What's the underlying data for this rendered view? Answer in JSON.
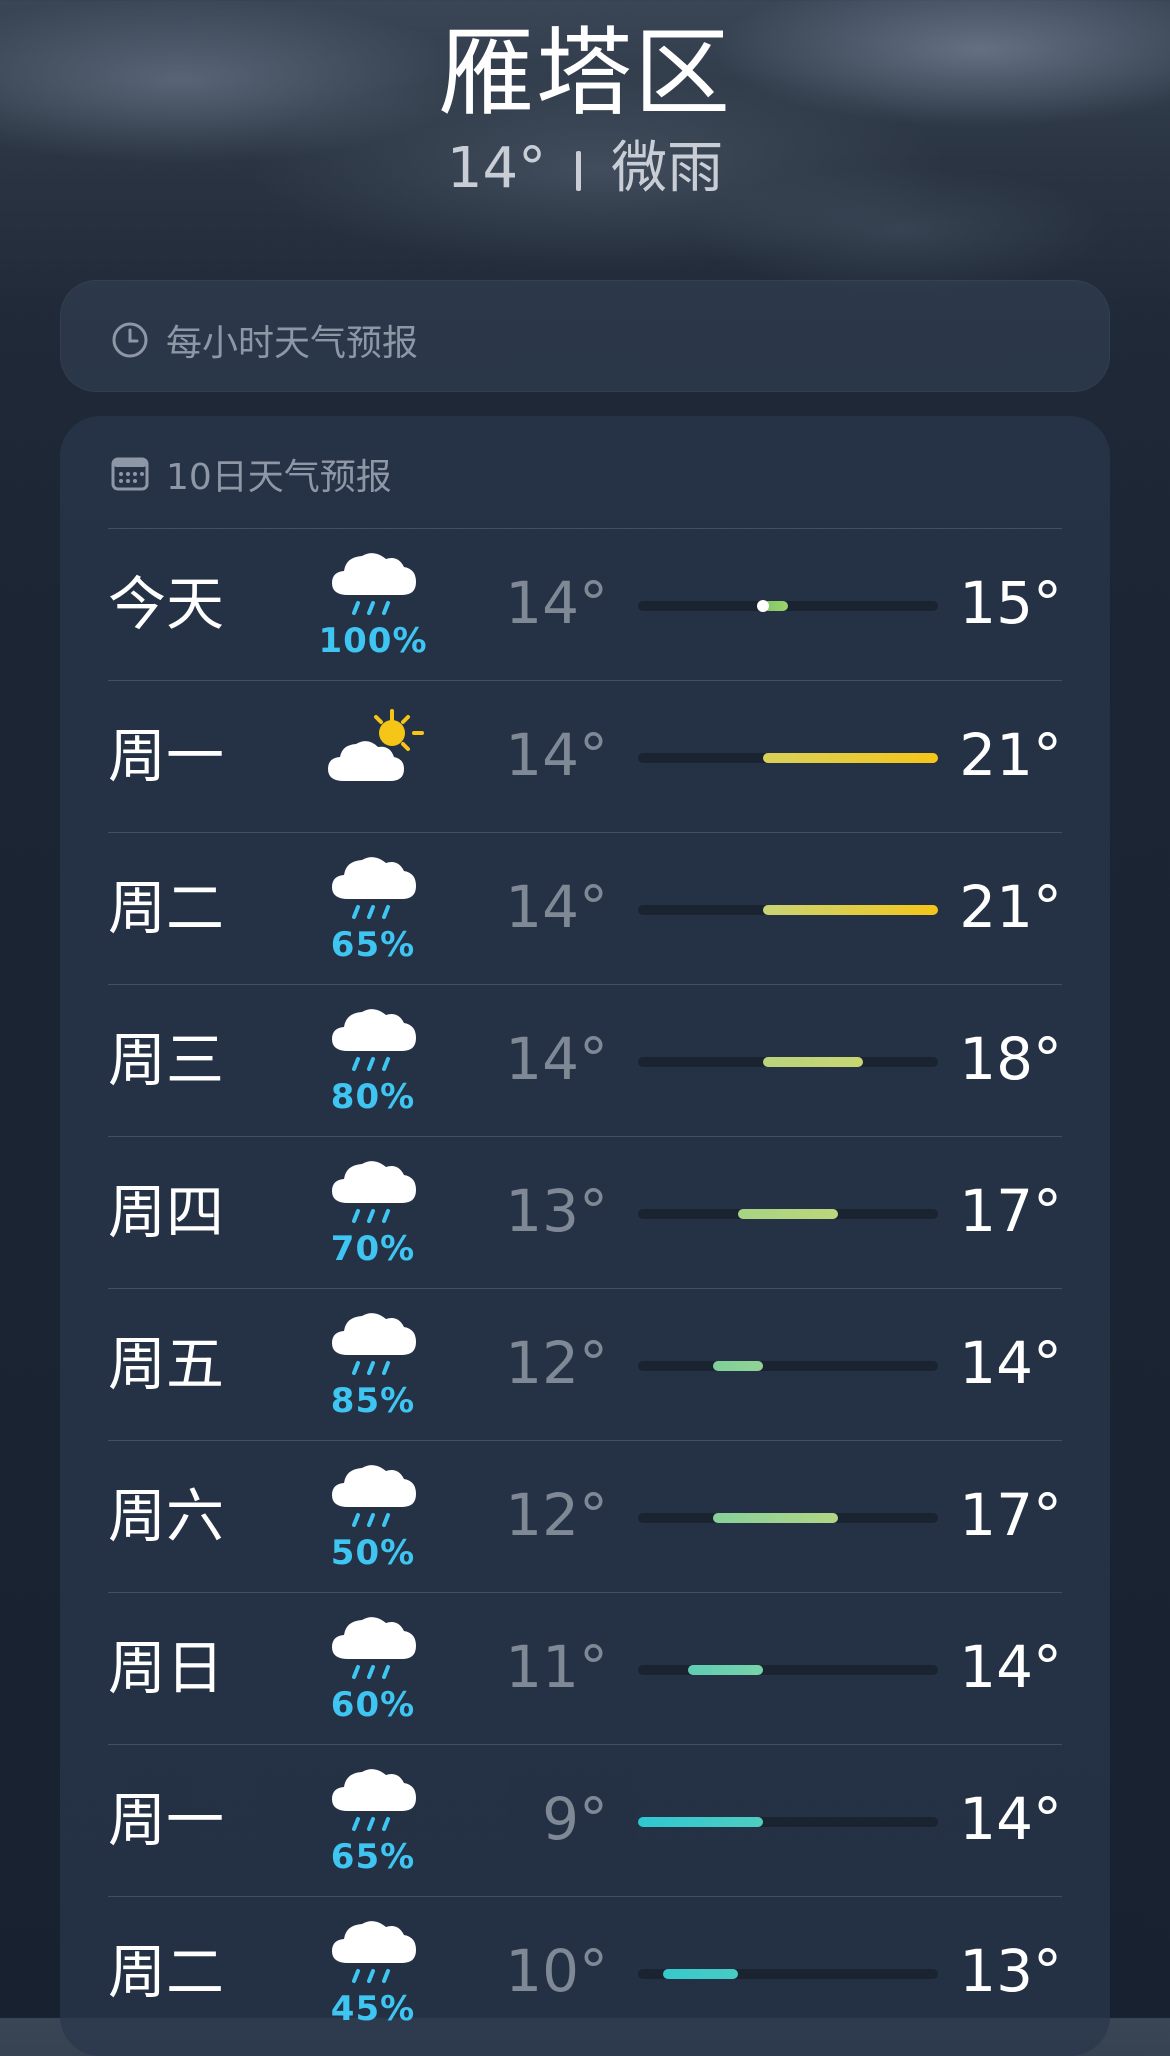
{
  "header": {
    "city": "雁塔区",
    "temperature": "14°",
    "condition": "微雨"
  },
  "hourly": {
    "label": "每小时天气预报",
    "icon": "clock-icon"
  },
  "ten_day": {
    "label": "10日天气预报",
    "icon": "calendar-icon",
    "range_min": 9,
    "range_max": 21,
    "current_temp": 14,
    "days": [
      {
        "day": "今天",
        "icon": "rain-cloud-icon",
        "precip": "100%",
        "low": "14°",
        "high": "15°",
        "low_value": 14,
        "high_value": 15,
        "color_start": "#7fc46a",
        "color_end": "#9ed36a",
        "show_current": true
      },
      {
        "day": "周一",
        "icon": "partly-sunny-icon",
        "precip": "",
        "low": "14°",
        "high": "21°",
        "low_value": 14,
        "high_value": 21,
        "color_start": "#d9d15a",
        "color_end": "#f5c518",
        "show_current": false
      },
      {
        "day": "周二",
        "icon": "rain-cloud-icon",
        "precip": "65%",
        "low": "14°",
        "high": "21°",
        "low_value": 14,
        "high_value": 21,
        "color_start": "#c9d476",
        "color_end": "#f5c518",
        "show_current": false
      },
      {
        "day": "周三",
        "icon": "rain-cloud-icon",
        "precip": "80%",
        "low": "14°",
        "high": "18°",
        "low_value": 14,
        "high_value": 18,
        "color_start": "#b9d47c",
        "color_end": "#c8d572",
        "show_current": false
      },
      {
        "day": "周四",
        "icon": "rain-cloud-icon",
        "precip": "70%",
        "low": "13°",
        "high": "17°",
        "low_value": 13,
        "high_value": 17,
        "color_start": "#a8d384",
        "color_end": "#bcd77c",
        "show_current": false
      },
      {
        "day": "周五",
        "icon": "rain-cloud-icon",
        "precip": "85%",
        "low": "12°",
        "high": "14°",
        "low_value": 12,
        "high_value": 14,
        "color_start": "#7fcf9a",
        "color_end": "#92d394",
        "show_current": false
      },
      {
        "day": "周六",
        "icon": "rain-cloud-icon",
        "precip": "50%",
        "low": "12°",
        "high": "17°",
        "low_value": 12,
        "high_value": 17,
        "color_start": "#86d19a",
        "color_end": "#b2d684",
        "show_current": false
      },
      {
        "day": "周日",
        "icon": "rain-cloud-icon",
        "precip": "60%",
        "low": "11°",
        "high": "14°",
        "low_value": 11,
        "high_value": 14,
        "color_start": "#5fcdb4",
        "color_end": "#78d2a8",
        "show_current": false
      },
      {
        "day": "周一",
        "icon": "rain-cloud-icon",
        "precip": "65%",
        "low": "9°",
        "high": "14°",
        "low_value": 9,
        "high_value": 14,
        "color_start": "#2ec8d2",
        "color_end": "#4fcdc0",
        "show_current": false
      },
      {
        "day": "周二",
        "icon": "rain-cloud-icon",
        "precip": "45%",
        "low": "10°",
        "high": "13°",
        "low_value": 10,
        "high_value": 13,
        "color_start": "#36c9cc",
        "color_end": "#48cbc4",
        "show_current": false
      }
    ]
  }
}
